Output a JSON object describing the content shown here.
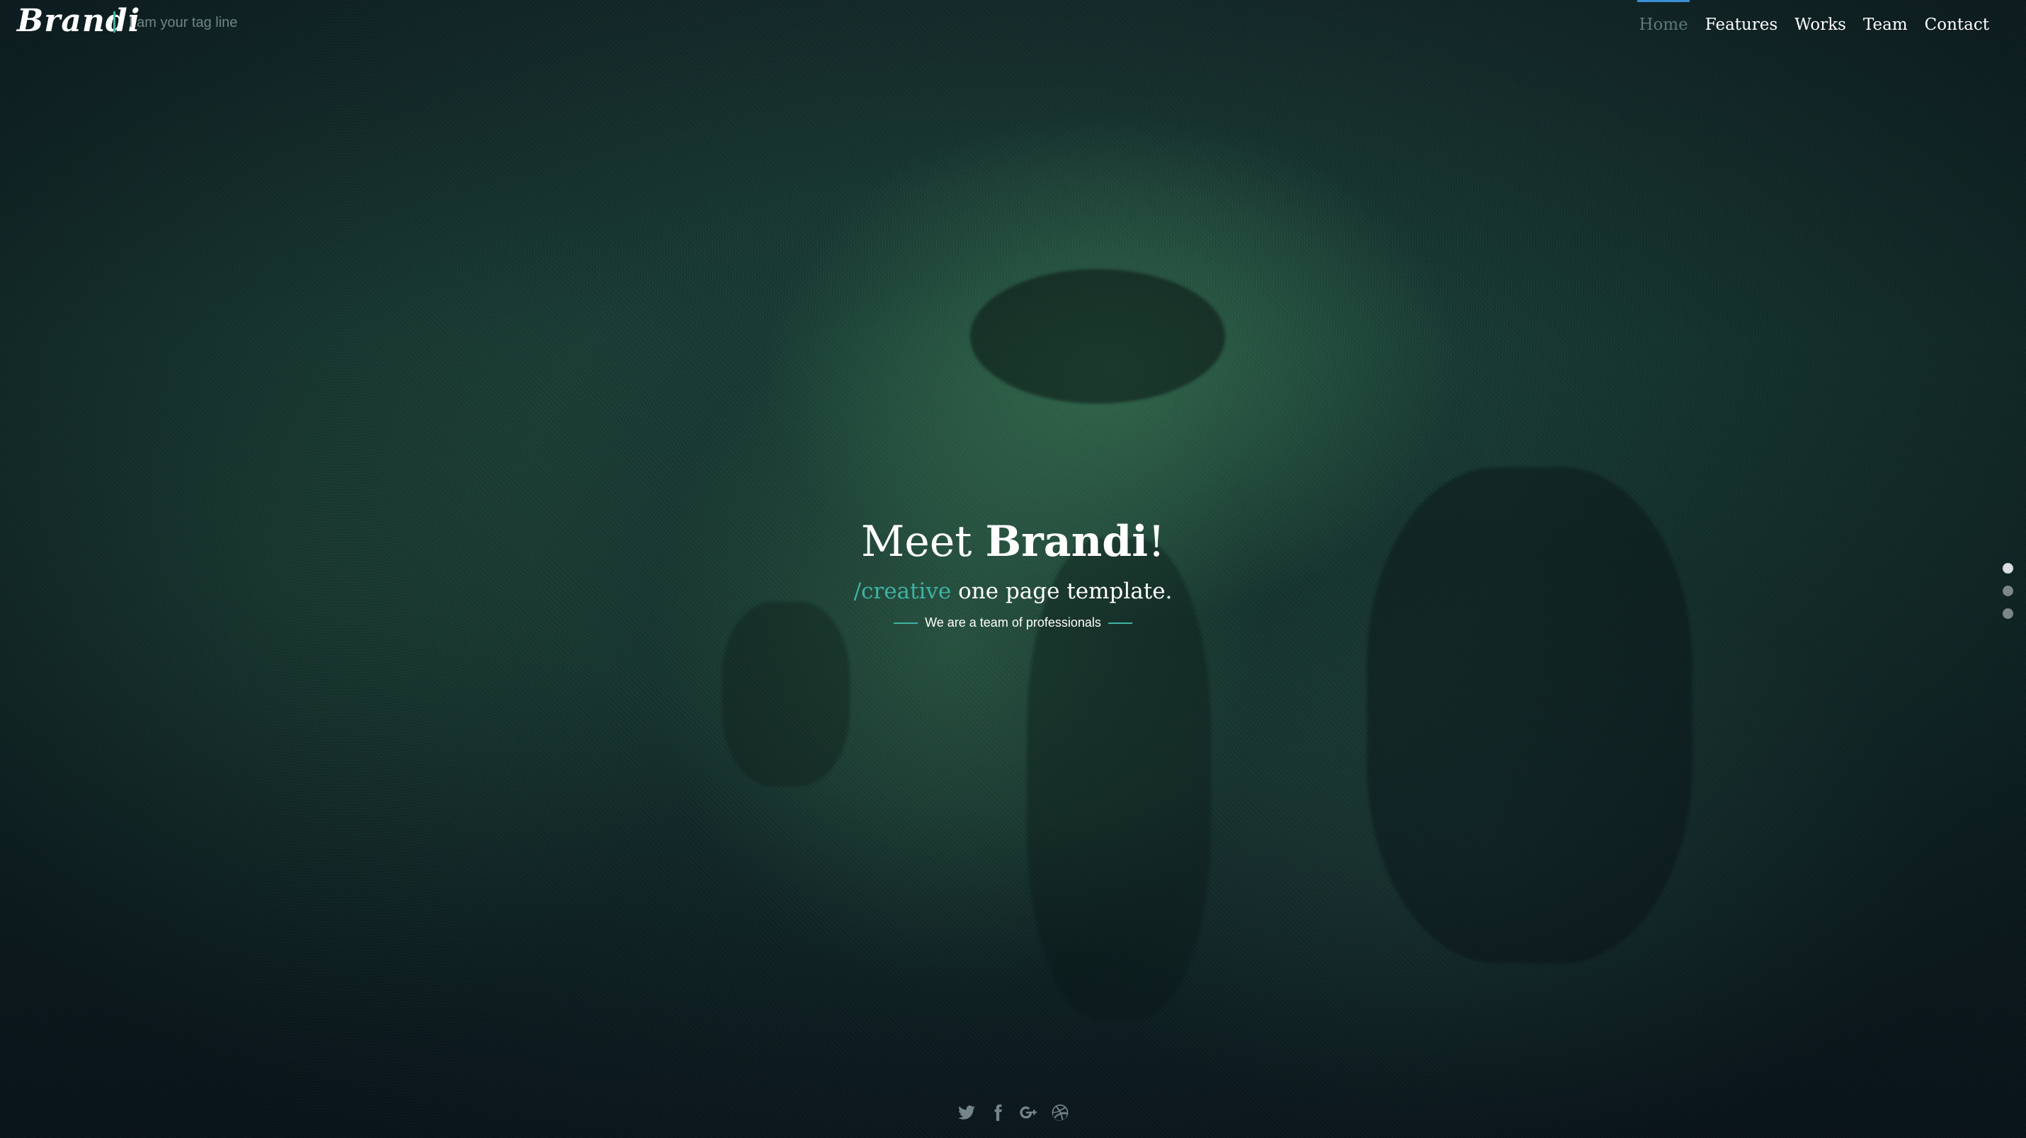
{
  "brand": {
    "logo": "Brandi",
    "tagline": "I am your tag line"
  },
  "nav": {
    "items": [
      {
        "label": "Home",
        "active": true
      },
      {
        "label": "Features",
        "active": false
      },
      {
        "label": "Works",
        "active": false
      },
      {
        "label": "Team",
        "active": false
      },
      {
        "label": "Contact",
        "active": false
      }
    ]
  },
  "hero": {
    "headline_prefix": "Meet ",
    "headline_strong": "Brandi",
    "headline_suffix": "!",
    "sub_accent": "/creative",
    "sub_rest": " one page template.",
    "small": "We are a team of professionals"
  },
  "slider": {
    "dots": 3,
    "active_index": 0
  },
  "social": {
    "icons": [
      "twitter-icon",
      "facebook-icon",
      "google-plus-icon",
      "dribbble-icon"
    ]
  },
  "colors": {
    "accent": "#3fb3a3",
    "active_bar": "#3a8fd0"
  }
}
